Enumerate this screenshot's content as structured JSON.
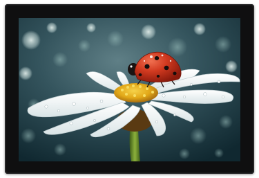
{
  "device": {
    "type": "wall-mounted display / tablet",
    "screen_content": "macro-photo-ladybug-on-daisy"
  },
  "colors": {
    "bezel": "#1b1b1c",
    "background_bokeh": "#2e4f5a",
    "ladybug": "#c8321c",
    "daisy_center": "#e8b21e",
    "stem": "#6a8f2c"
  }
}
